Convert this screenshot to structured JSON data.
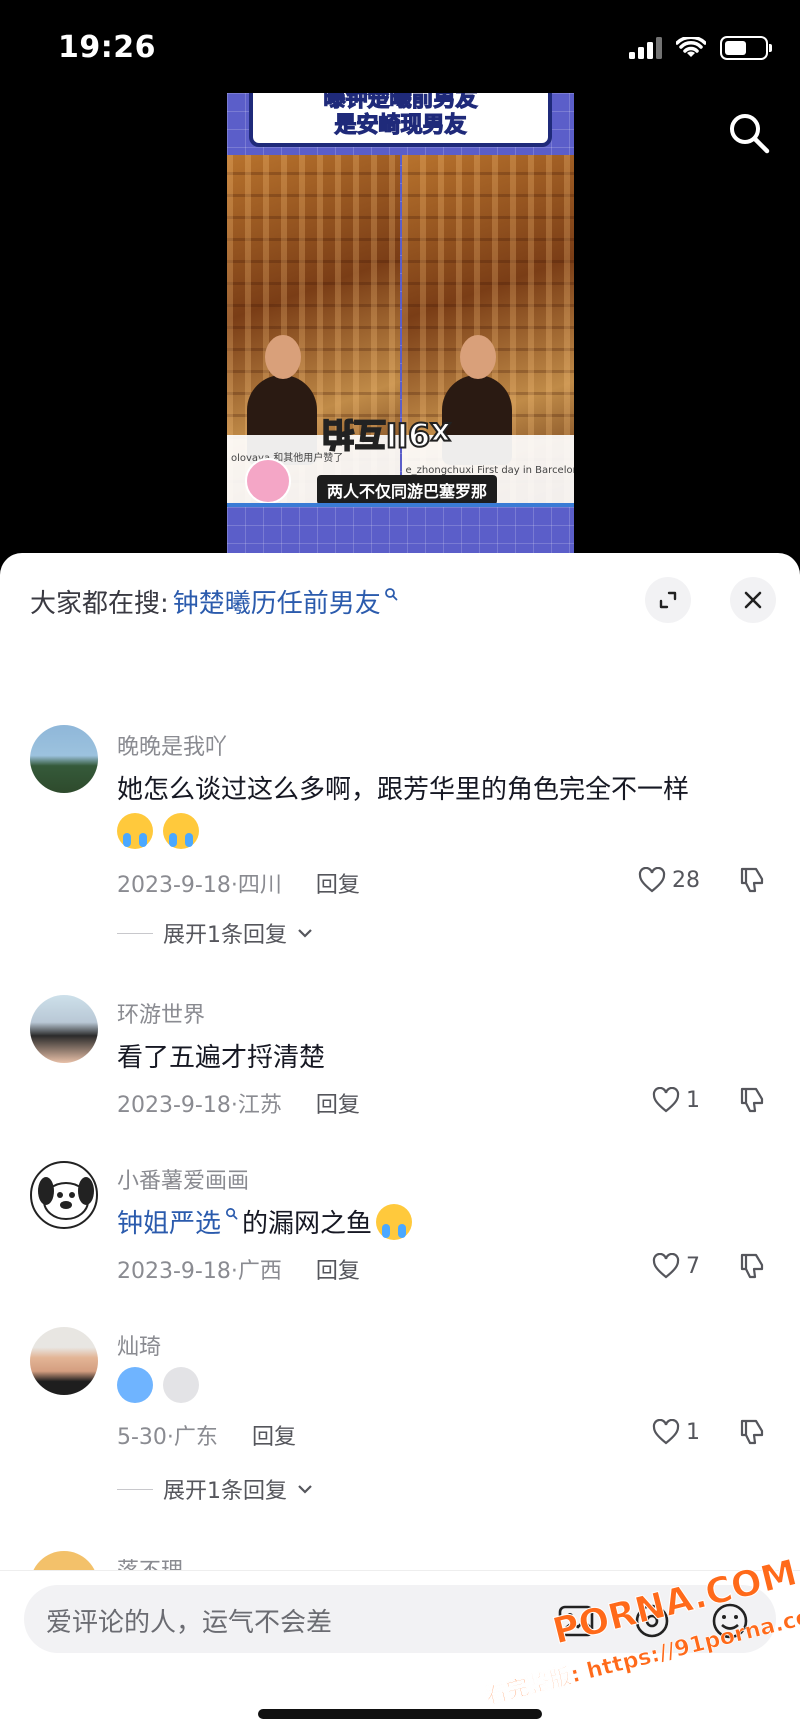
{
  "status_bar": {
    "time": "19:26",
    "battery_level": 0.55
  },
  "video": {
    "banner_line1": "曝钟楚曦前男友",
    "banner_line2": "是安崎现男友",
    "sticker_text": "x9ll互拍",
    "subtitle": "两人不仅同游巴塞罗那",
    "caption_left": "olovaya 和其他用户赞了",
    "caption_right": "e_zhongchuxi First day in Barcelona."
  },
  "sheet": {
    "hot_search_label": "大家都在搜:",
    "hot_search_term": "钟楚曦历任前男友"
  },
  "comments": [
    {
      "username": "晚晚是我吖",
      "text": "她怎么谈过这么多啊，跟芳华里的角色完全不一样",
      "emojis": [
        "cry",
        "cry"
      ],
      "date_location": "2023-9-18·四川",
      "reply_label": "回复",
      "likes": "28",
      "expand_label": "展开1条回复"
    },
    {
      "username": "环游世界",
      "text": "看了五遍才捋清楚",
      "date_location": "2023-9-18·江苏",
      "reply_label": "回复",
      "likes": "1"
    },
    {
      "username": "小番薯爱画画",
      "link_text": "钟姐严选",
      "text": "的漏网之鱼",
      "emojis": [
        "cry"
      ],
      "date_location": "2023-9-18·广西",
      "reply_label": "回复",
      "likes": "7"
    },
    {
      "username": "灿琦",
      "emojis": [
        "scared",
        "dizzy"
      ],
      "date_location": "5-30·广东",
      "reply_label": "回复",
      "likes": "1",
      "expand_label": "展开1条回复"
    },
    {
      "username": "落不理-"
    }
  ],
  "input_bar": {
    "placeholder": "爱评论的人，运气不会差"
  },
  "watermark": {
    "brand": "PORNA.COM",
    "url": "看完整版: https://91porna.com"
  }
}
